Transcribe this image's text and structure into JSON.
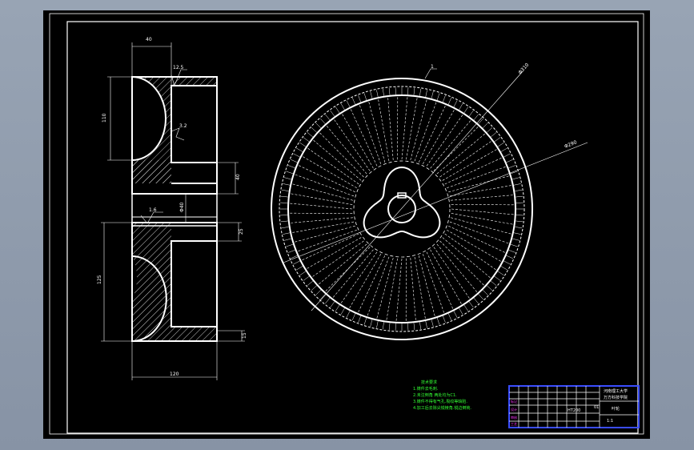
{
  "drawing": {
    "section_view": {
      "dim_top": "40",
      "dim_left_upper": "110",
      "dim_left_lower": "125",
      "dim_bottom": "120",
      "dim_right_a": "40",
      "dim_right_b": "25",
      "dim_right_c": "15",
      "hub_bore": "Φ40",
      "roughness_a": "12.5",
      "roughness_b": "3.2",
      "roughness_c": "1.6"
    },
    "front_view": {
      "dia_outer": "Φ310",
      "dia_inner": "Φ290",
      "callout": "1"
    },
    "notes": {
      "title": "技术要求",
      "lines": [
        "1.铸件去毛刺.",
        "2.未注倒角  两处均为C1.",
        "3.铸件不得有气孔.裂纹等缺陷.",
        "4.加工后去除尖锐棱角.锐边倒钝."
      ]
    },
    "title_block": {
      "school": "河南理工大学",
      "school2": "万方科技学院",
      "part_name": "叶轮",
      "drawing_no": "1:1",
      "scale": "01",
      "material": "HT200",
      "magenta_labels": [
        "标记",
        "设计",
        "审核",
        "工艺"
      ]
    }
  }
}
